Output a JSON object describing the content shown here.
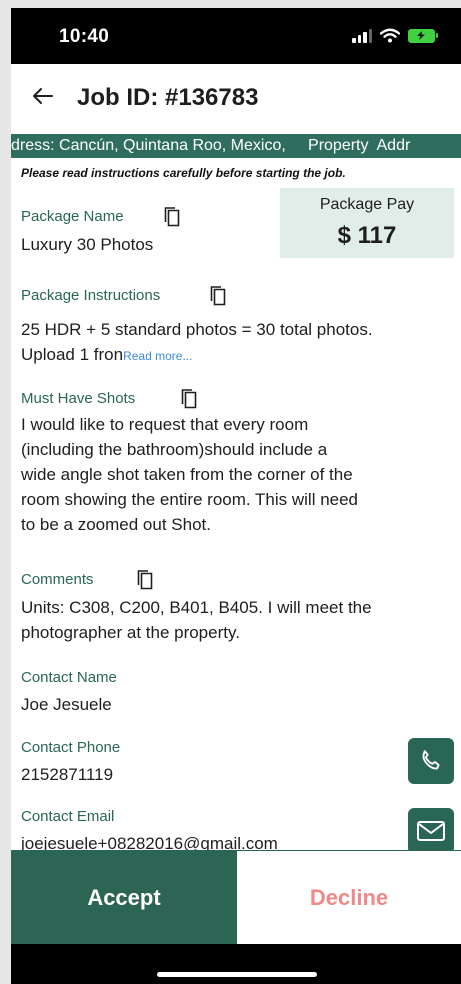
{
  "status_bar": {
    "time": "10:40"
  },
  "header": {
    "title": "Job ID: #136783"
  },
  "ticker": {
    "text": "dress: Cancún, Quintana Roo, Mexico,     Property  Addr"
  },
  "notice": "Please read instructions carefully before starting the job.",
  "package": {
    "label": "Package Name",
    "value": "Luxury 30 Photos"
  },
  "pay": {
    "label": "Package Pay",
    "amount": "$ 117"
  },
  "instructions": {
    "label": "Package Instructions",
    "line1": "25 HDR + 5 standard photos = 30 total photos.",
    "line2": "Upload 1 fron",
    "read_more": "Read more..."
  },
  "must_have": {
    "label": "Must Have Shots",
    "lines": [
      "I would like to request that every room",
      "(including the bathroom)should include a",
      "wide angle shot taken from the corner of the",
      "room showing the entire room. This will need",
      "to be a zoomed out Shot."
    ]
  },
  "comments": {
    "label": "Comments",
    "lines": [
      "Units: C308, C200, B401, B405. I will meet the",
      "photographer at the property."
    ]
  },
  "contact_name": {
    "label": "Contact Name",
    "value": "Joe Jesuele"
  },
  "contact_phone": {
    "label": "Contact Phone",
    "value": "2152871119"
  },
  "contact_email": {
    "label": "Contact Email",
    "value": "joejesuele+08282016@gmail.com"
  },
  "actions": {
    "accept": "Accept",
    "decline": "Decline"
  },
  "colors": {
    "brand": "#2a6656",
    "ticker": "#2f6d5e",
    "pay_bg": "#e1ede9",
    "decline": "#ef8a8a",
    "link": "#3c8de0"
  },
  "icons": {
    "back": "arrow-left-icon",
    "copy": "copy-icon",
    "phone": "phone-icon",
    "mail": "mail-icon",
    "signal": "signal-icon",
    "wifi": "wifi-icon",
    "battery": "battery-charging-icon"
  }
}
